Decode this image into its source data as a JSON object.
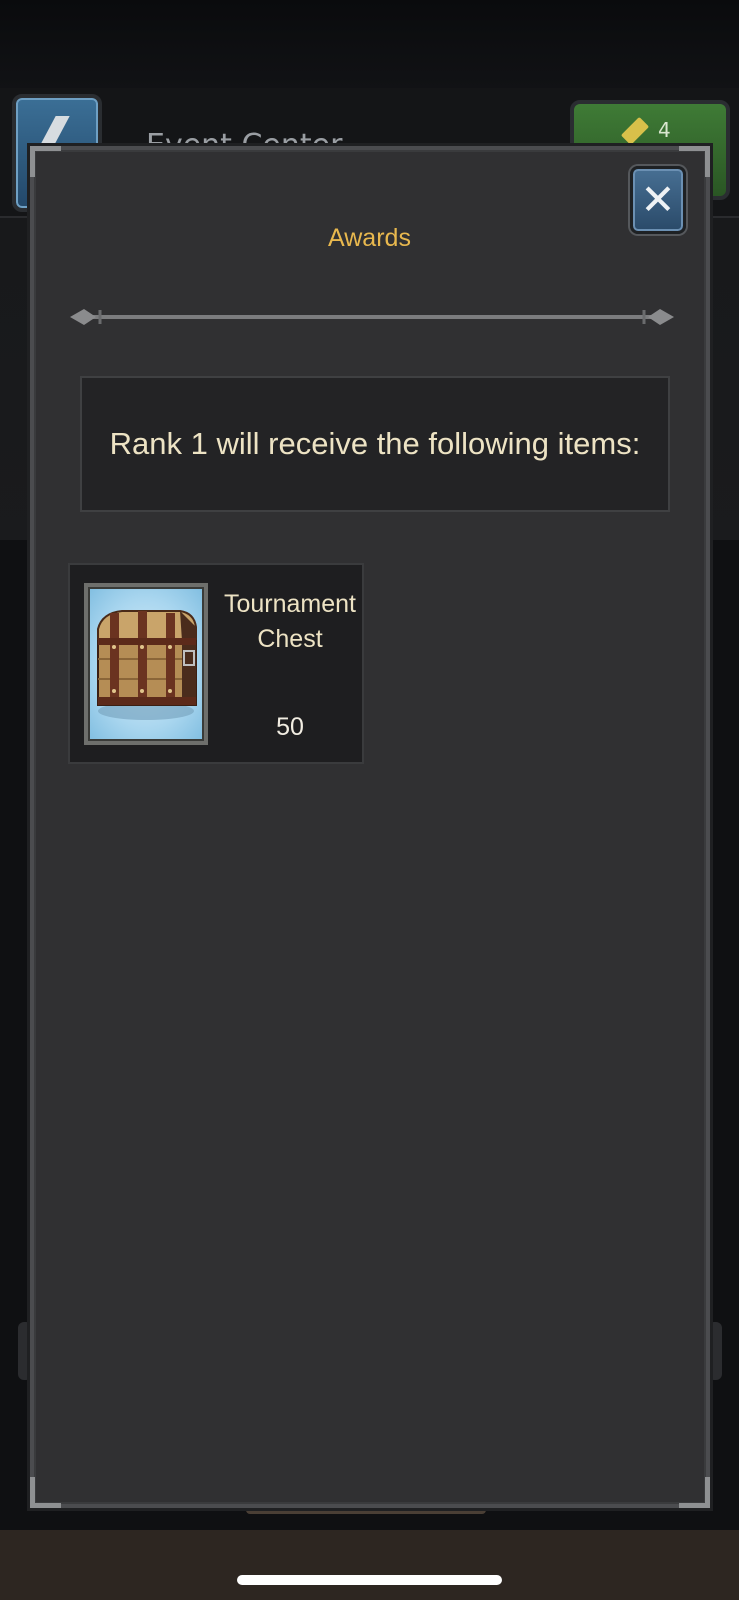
{
  "background": {
    "title": "Event Center",
    "currency_count": "4"
  },
  "modal": {
    "title": "Awards",
    "close_label": "✕",
    "rank_text": "Rank 1 will receive the following items:",
    "items": [
      {
        "name": "Tournament Chest",
        "quantity": "50",
        "icon": "chest-icon"
      }
    ]
  },
  "colors": {
    "title_gold": "#e8b84e",
    "text_cream": "#ede3c4",
    "panel": "#303032",
    "close_blue": "#3a5f82"
  }
}
